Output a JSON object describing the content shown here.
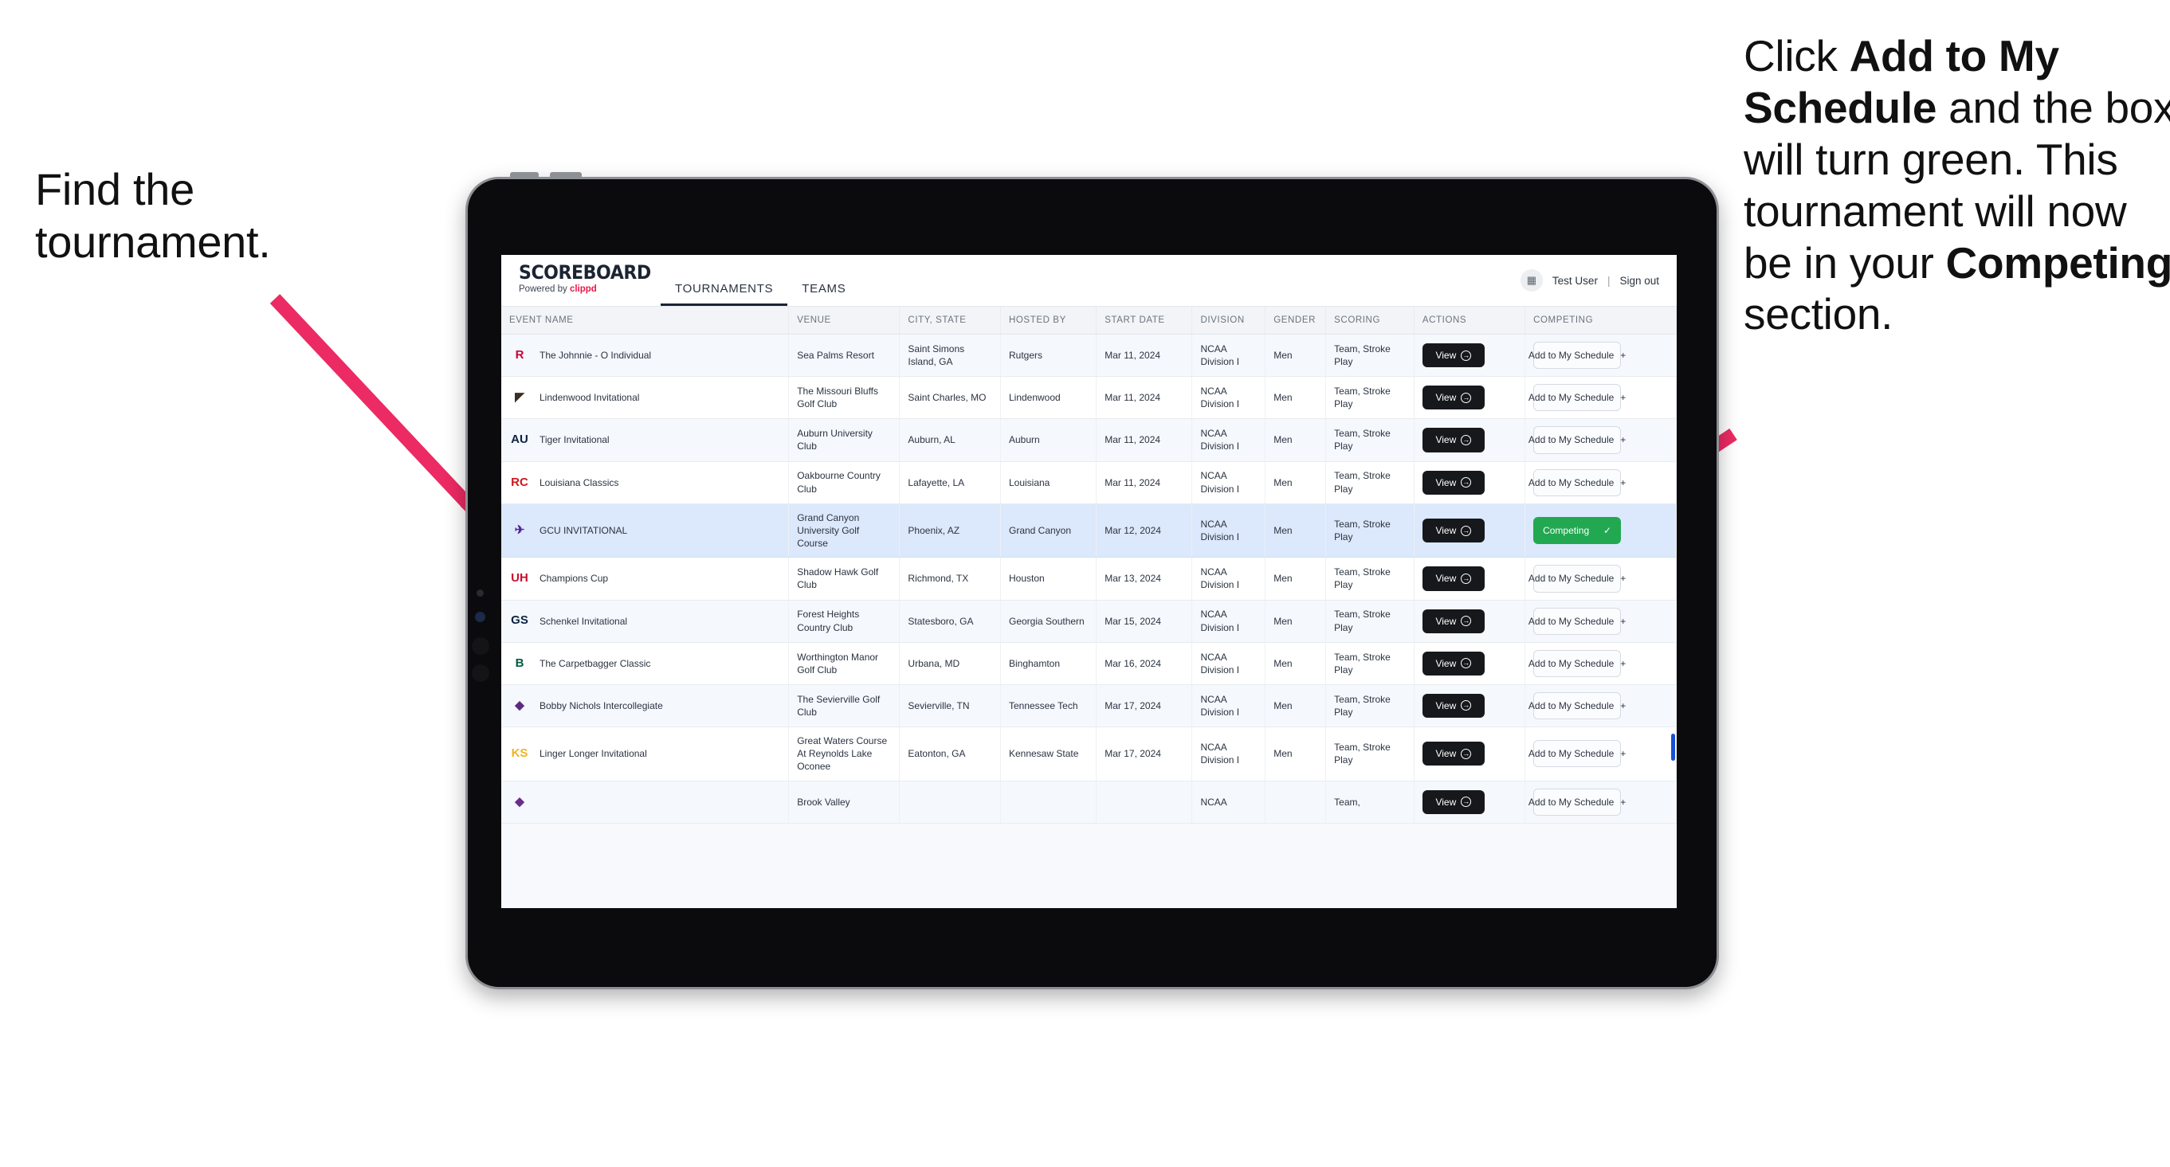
{
  "annotations": {
    "left": "Find the tournament.",
    "right_parts": [
      {
        "t": "Click ",
        "b": false
      },
      {
        "t": "Add to My Schedule",
        "b": true
      },
      {
        "t": " and the box will turn green. This tournament will now be in your ",
        "b": false
      },
      {
        "t": "Competing",
        "b": true
      },
      {
        "t": " section.",
        "b": false
      }
    ],
    "arrow_color": "#ec2a63"
  },
  "app": {
    "brand_title": "SCOREBOARD",
    "brand_sub_prefix": "Powered by ",
    "brand_sub_name": "clippd",
    "tabs": [
      {
        "label": "TOURNAMENTS",
        "active": true
      },
      {
        "label": "TEAMS",
        "active": false
      }
    ],
    "user": {
      "avatar_icon": "grid-icon",
      "name": "Test User",
      "separator": "|",
      "signout": "Sign out"
    }
  },
  "table": {
    "headers": [
      "EVENT NAME",
      "VENUE",
      "CITY, STATE",
      "HOSTED BY",
      "START DATE",
      "DIVISION",
      "GENDER",
      "SCORING",
      "ACTIONS",
      "COMPETING"
    ],
    "view_label": "View",
    "add_label": "Add to My Schedule",
    "add_icon": "plus-icon",
    "competing_label": "Competing",
    "competing_icon": "check-icon",
    "rows": [
      {
        "logo": "R",
        "logo_color": "#cc0033",
        "name": "The Johnnie - O Individual",
        "venue": "Sea Palms Resort",
        "city": "Saint Simons Island, GA",
        "host": "Rutgers",
        "date": "Mar 11, 2024",
        "division": "NCAA Division I",
        "gender": "Men",
        "scoring": "Team, Stroke Play",
        "competing": false
      },
      {
        "logo": "◤",
        "logo_color": "#3b2f23",
        "name": "Lindenwood Invitational",
        "venue": "The Missouri Bluffs Golf Club",
        "city": "Saint Charles, MO",
        "host": "Lindenwood",
        "date": "Mar 11, 2024",
        "division": "NCAA Division I",
        "gender": "Men",
        "scoring": "Team, Stroke Play",
        "competing": false
      },
      {
        "logo": "AU",
        "logo_color": "#0c2340",
        "name": "Tiger Invitational",
        "venue": "Auburn University Club",
        "city": "Auburn, AL",
        "host": "Auburn",
        "date": "Mar 11, 2024",
        "division": "NCAA Division I",
        "gender": "Men",
        "scoring": "Team, Stroke Play",
        "competing": false
      },
      {
        "logo": "RC",
        "logo_color": "#ce181e",
        "name": "Louisiana Classics",
        "venue": "Oakbourne Country Club",
        "city": "Lafayette, LA",
        "host": "Louisiana",
        "date": "Mar 11, 2024",
        "division": "NCAA Division I",
        "gender": "Men",
        "scoring": "Team, Stroke Play",
        "competing": false
      },
      {
        "logo": "✈",
        "logo_color": "#522398",
        "name": "GCU INVITATIONAL",
        "venue": "Grand Canyon University Golf Course",
        "city": "Phoenix, AZ",
        "host": "Grand Canyon",
        "date": "Mar 12, 2024",
        "division": "NCAA Division I",
        "gender": "Men",
        "scoring": "Team, Stroke Play",
        "competing": true
      },
      {
        "logo": "UH",
        "logo_color": "#c8102e",
        "name": "Champions Cup",
        "venue": "Shadow Hawk Golf Club",
        "city": "Richmond, TX",
        "host": "Houston",
        "date": "Mar 13, 2024",
        "division": "NCAA Division I",
        "gender": "Men",
        "scoring": "Team, Stroke Play",
        "competing": false
      },
      {
        "logo": "GS",
        "logo_color": "#0b2240",
        "name": "Schenkel Invitational",
        "venue": "Forest Heights Country Club",
        "city": "Statesboro, GA",
        "host": "Georgia Southern",
        "date": "Mar 15, 2024",
        "division": "NCAA Division I",
        "gender": "Men",
        "scoring": "Team, Stroke Play",
        "competing": false
      },
      {
        "logo": "B",
        "logo_color": "#005a43",
        "name": "The Carpetbagger Classic",
        "venue": "Worthington Manor Golf Club",
        "city": "Urbana, MD",
        "host": "Binghamton",
        "date": "Mar 16, 2024",
        "division": "NCAA Division I",
        "gender": "Men",
        "scoring": "Team, Stroke Play",
        "competing": false
      },
      {
        "logo": "◆",
        "logo_color": "#5c2a84",
        "name": "Bobby Nichols Intercollegiate",
        "venue": "The Sevierville Golf Club",
        "city": "Sevierville, TN",
        "host": "Tennessee Tech",
        "date": "Mar 17, 2024",
        "division": "NCAA Division I",
        "gender": "Men",
        "scoring": "Team, Stroke Play",
        "competing": false
      },
      {
        "logo": "KS",
        "logo_color": "#f0b323",
        "name": "Linger Longer Invitational",
        "venue": "Great Waters Course At Reynolds Lake Oconee",
        "city": "Eatonton, GA",
        "host": "Kennesaw State",
        "date": "Mar 17, 2024",
        "division": "NCAA Division I",
        "gender": "Men",
        "scoring": "Team, Stroke Play",
        "competing": false
      },
      {
        "logo": "◆",
        "logo_color": "#6b2d8c",
        "name": "",
        "venue": "Brook Valley",
        "city": "",
        "host": "",
        "date": "",
        "division": "NCAA",
        "gender": "",
        "scoring": "Team,",
        "competing": false
      }
    ]
  }
}
